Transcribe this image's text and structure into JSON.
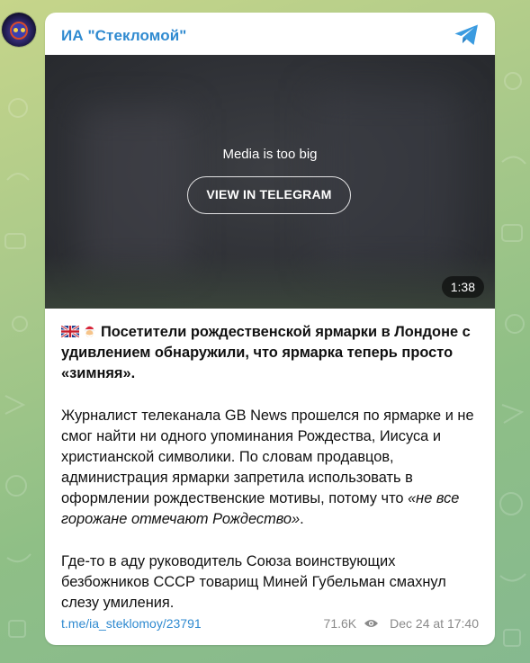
{
  "channel": {
    "name": "ИА \"Стекломой\""
  },
  "media": {
    "message": "Media is too big",
    "button_label": "VIEW IN TELEGRAM",
    "duration": "1:38"
  },
  "post": {
    "headline": "Посетители рождественской ярмарки в Лондоне с удивлением обнаружили, что ярмарка теперь просто «зимняя».",
    "paragraph1_main": "Журналист телеканала GB News прошелся по ярмарке и не смог найти ни одного упоминания Рождества, Иисуса и христианской символики. По словам продавцов, администрация ярмарки запретила использовать в оформлении рождественские мотивы, потому что ",
    "paragraph1_quote": "«не все горожане отмечают Рождество»",
    "paragraph1_end": ".",
    "paragraph2": "Где-то в аду руководитель Союза воинствующих безбожников СССР товарищ Миней Губельман смахнул слезу умиления."
  },
  "footer": {
    "link": "t.me/ia_steklomoy/23791",
    "views": "71.6K",
    "date": "Dec 24 at 17:40"
  },
  "icons": {
    "telegram": "telegram-plane-icon",
    "flag": "uk-flag-icon",
    "santa": "santa-emoji-icon",
    "views": "eye-icon"
  },
  "colors": {
    "accent": "#2f8ad0",
    "meta": "#8a8a8a"
  }
}
